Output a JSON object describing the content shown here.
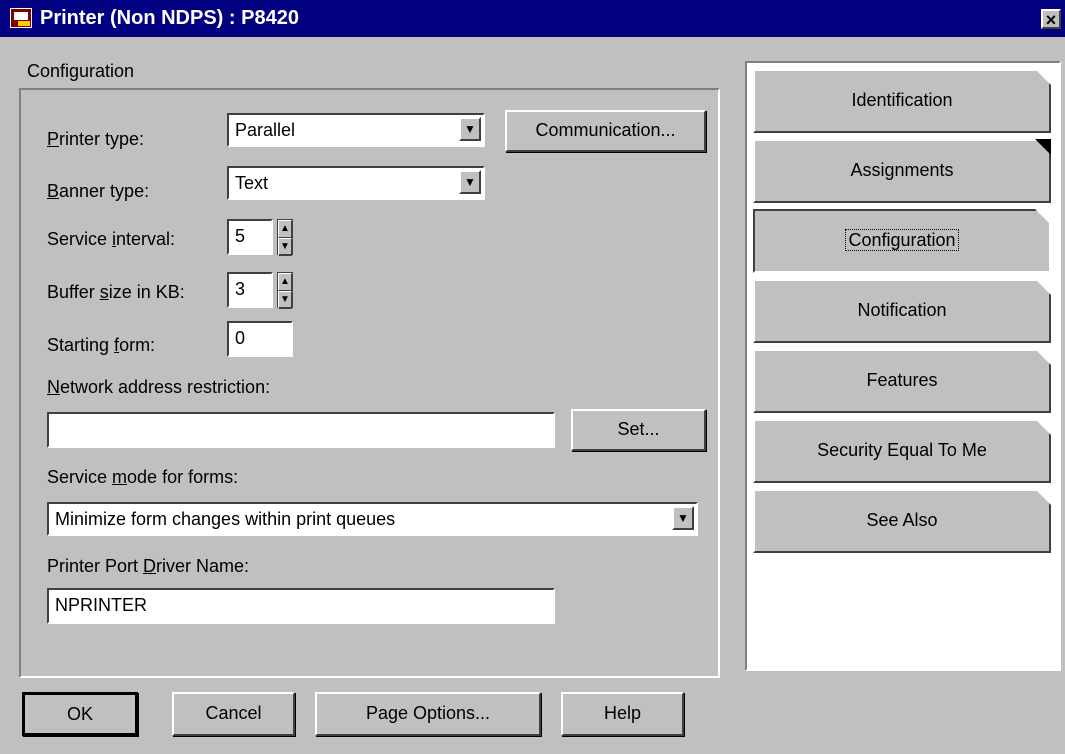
{
  "window": {
    "title": "Printer (Non NDPS) : P8420",
    "close_label": "×"
  },
  "section_label": "Configuration",
  "form": {
    "printer_type": {
      "label": "Printer type:",
      "value": "Parallel"
    },
    "banner_type": {
      "label": "Banner type:",
      "value": "Text"
    },
    "service_interval": {
      "label": "Service interval:",
      "value": "5"
    },
    "buffer_size": {
      "label": "Buffer size in KB:",
      "value": "3"
    },
    "starting_form": {
      "label": "Starting form:",
      "value": "0"
    },
    "network_address": {
      "label": "Network address restriction:",
      "value": ""
    },
    "service_mode": {
      "label": "Service mode for forms:",
      "value": "Minimize form changes within print queues"
    },
    "port_driver": {
      "label": "Printer Port Driver Name:",
      "value": "NPRINTER"
    },
    "communication_button": "Communication...",
    "set_button": "Set..."
  },
  "tabs": [
    "Identification",
    "Assignments",
    "Configuration",
    "Notification",
    "Features",
    "Security Equal To Me",
    "See Also"
  ],
  "buttons": {
    "ok": "OK",
    "cancel": "Cancel",
    "page_options": "Page Options...",
    "help": "Help"
  }
}
